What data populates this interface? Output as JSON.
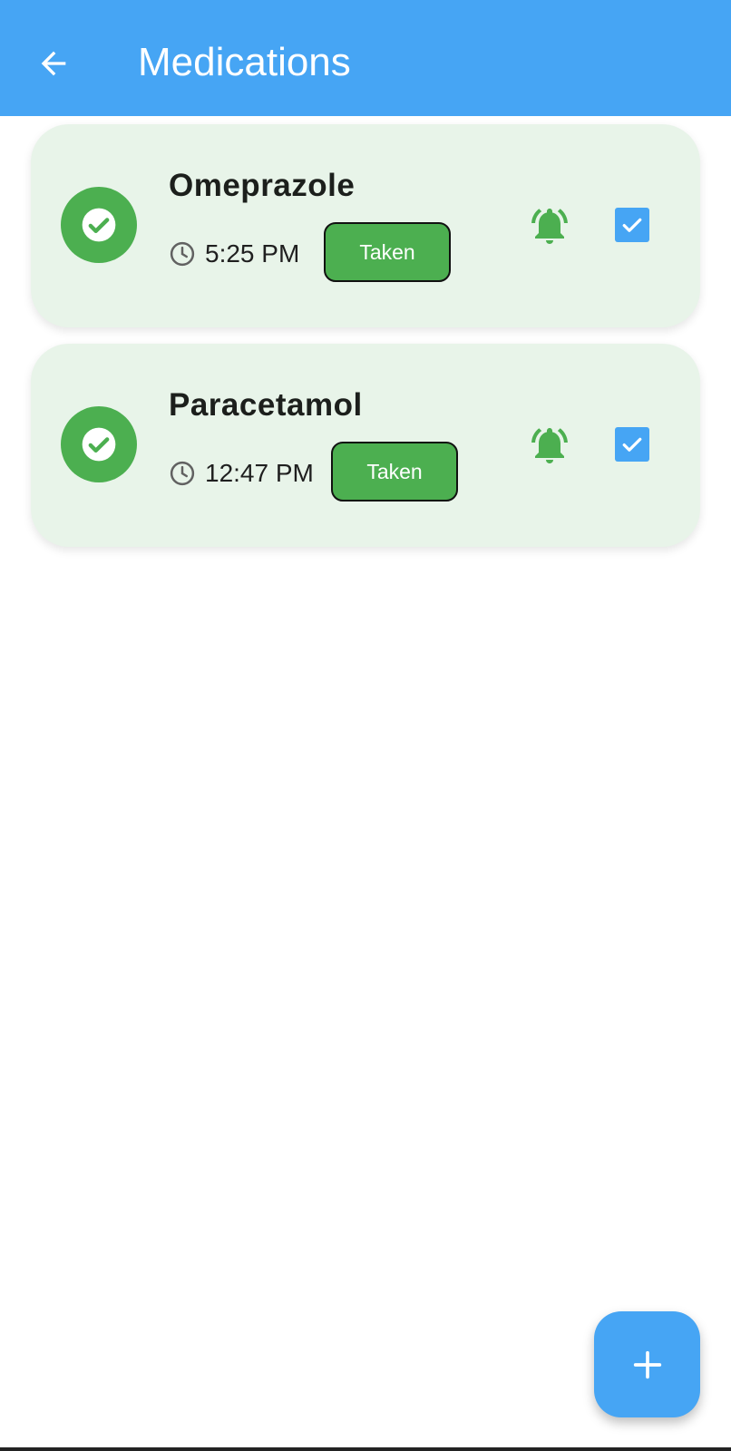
{
  "appbar": {
    "title": "Medications",
    "back_icon": "arrow-left-icon",
    "color": "#46a5f4"
  },
  "medications": [
    {
      "name": "Omeprazole",
      "time": "5:25 PM",
      "status_label": "Taken",
      "status_icon": "check-circle-icon",
      "alarm_icon": "alarm-bell-icon",
      "checked": true
    },
    {
      "name": "Paracetamol",
      "time": "12:47 PM",
      "status_label": "Taken",
      "status_icon": "check-circle-icon",
      "alarm_icon": "alarm-bell-icon",
      "checked": true
    }
  ],
  "fab": {
    "icon": "plus-icon"
  },
  "colors": {
    "card_bg": "#e8f4e9",
    "green": "#4caf50",
    "blue": "#46a5f4"
  }
}
